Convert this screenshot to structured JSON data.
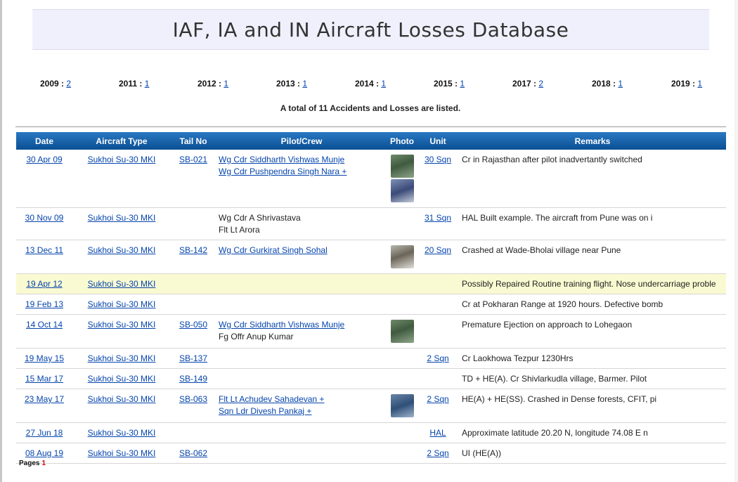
{
  "title": "IAF, IA and IN Aircraft Losses Database",
  "years": [
    {
      "label": "2009",
      "count": "2"
    },
    {
      "label": "2011",
      "count": "1"
    },
    {
      "label": "2012",
      "count": "1"
    },
    {
      "label": "2013",
      "count": "1"
    },
    {
      "label": "2014",
      "count": "1"
    },
    {
      "label": "2015",
      "count": "1"
    },
    {
      "label": "2017",
      "count": "2"
    },
    {
      "label": "2018",
      "count": "1"
    },
    {
      "label": "2019",
      "count": "1"
    }
  ],
  "total_text": "A total of 11 Accidents and Losses are listed.",
  "columns": [
    "Date",
    "Aircraft Type",
    "Tail No",
    "Pilot/Crew",
    "Photo",
    "Unit",
    "Remarks"
  ],
  "rows": [
    {
      "date": "30 Apr 09",
      "aircraft": "Sukhoi Su-30 MKI",
      "tail": "SB-021",
      "crew1": "Wg Cdr Siddharth Vishwas Munje",
      "crew2": "Wg Cdr Pushpendra Singh Nara +",
      "unit": "30 Sqn",
      "remarks": "Cr in Rajasthan after pilot inadvertantly switched"
    },
    {
      "date": "30 Nov 09",
      "aircraft": "Sukhoi Su-30 MKI",
      "tail": "",
      "crew1": "Wg Cdr A Shrivastava",
      "crew2": "Flt Lt Arora",
      "unit": "31 Sqn",
      "remarks": "HAL Built example. The aircraft from Pune was on i"
    },
    {
      "date": "13 Dec 11",
      "aircraft": "Sukhoi Su-30 MKI",
      "tail": "SB-142",
      "crew1": "Wg Cdr Gurkirat Singh Sohal",
      "crew2": "",
      "unit": "20 Sqn",
      "remarks": "Crashed at Wade-Bholai village near Pune"
    },
    {
      "date": "19 Apr 12",
      "aircraft": "Sukhoi Su-30 MKI",
      "tail": "",
      "crew1": "",
      "crew2": "",
      "unit": "",
      "remarks": "Possibly Repaired Routine training flight. Nose undercarriage proble"
    },
    {
      "date": "19 Feb 13",
      "aircraft": "Sukhoi Su-30 MKI",
      "tail": "",
      "crew1": "",
      "crew2": "",
      "unit": "",
      "remarks": "Cr at Pokharan Range at 1920 hours. Defective bomb"
    },
    {
      "date": "14 Oct 14",
      "aircraft": "Sukhoi Su-30 MKI",
      "tail": "SB-050",
      "crew1": "Wg Cdr Siddharth Vishwas Munje",
      "crew2": "Fg Offr Anup Kumar",
      "unit": "",
      "remarks": "Premature Ejection on approach to Lohegaon"
    },
    {
      "date": "19 May 15",
      "aircraft": "Sukhoi Su-30 MKI",
      "tail": "SB-137",
      "crew1": "",
      "crew2": "",
      "unit": "2 Sqn",
      "remarks": "Cr Laokhowa Tezpur 1230Hrs"
    },
    {
      "date": "15 Mar 17",
      "aircraft": "Sukhoi Su-30 MKI",
      "tail": "SB-149",
      "crew1": "",
      "crew2": "",
      "unit": "",
      "remarks": "TD + HE(A). Cr Shivlarkudla village, Barmer. Pilot"
    },
    {
      "date": "23 May 17",
      "aircraft": "Sukhoi Su-30 MKI",
      "tail": "SB-063",
      "crew1": "Flt Lt Achudev Sahadevan +",
      "crew2": "Sqn Ldr Divesh Pankaj +",
      "unit": "2 Sqn",
      "remarks": "HE(A) + HE(SS). Crashed in Dense forests, CFIT, pi"
    },
    {
      "date": "27 Jun 18",
      "aircraft": "Sukhoi Su-30 MKI",
      "tail": "",
      "crew1": "",
      "crew2": "",
      "unit": "HAL",
      "remarks": "Approximate latitude 20.20 N, longitude 74.08 E n"
    },
    {
      "date": "08 Aug 19",
      "aircraft": "Sukhoi Su-30 MKI",
      "tail": "SB-062",
      "crew1": "",
      "crew2": "",
      "unit": "2 Sqn",
      "remarks": "UI (HE(A))"
    }
  ],
  "pages_label": "Pages",
  "pages_current": "1"
}
